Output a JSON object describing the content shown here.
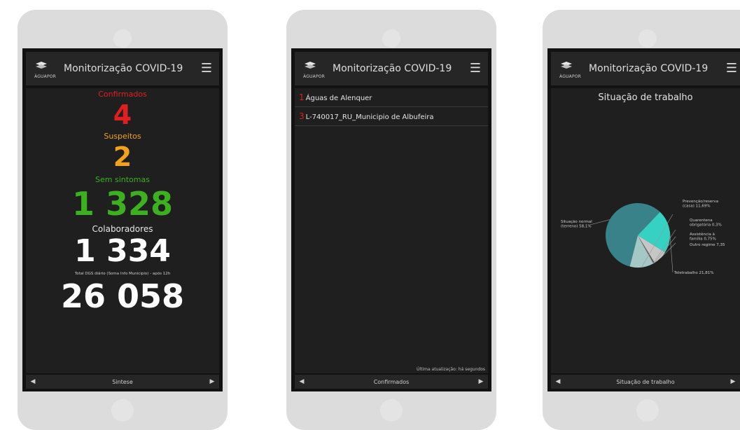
{
  "colors": {
    "confirmed": "#e02020",
    "suspected": "#f2a31b",
    "no_symptoms": "#3cb021",
    "white": "#ffffff",
    "app_bar": "#262626",
    "screen_bg": "#1f1f1f"
  },
  "phones": [
    {
      "app_title": "Monitorização COVID-19",
      "logo_text": "ÀGUAPOR",
      "menu_icon": "☰",
      "stats": {
        "confirmed_label": "Confirmados",
        "confirmed_value": "4",
        "suspected_label": "Suspeitos",
        "suspected_value": "2",
        "no_symptoms_label": "Sem sintomas",
        "no_symptoms_value": "1 328",
        "employees_label": "Colaboradores",
        "employees_value": "1 334",
        "dgs_label": "Total DGS diário (Soma Info Municipio) - após 12h",
        "dgs_value": "26 058"
      },
      "footer": {
        "prev": "◀",
        "label": "Sintese",
        "next": "▶"
      }
    },
    {
      "app_title": "Monitorização COVID-19",
      "logo_text": "ÀGUAPOR",
      "menu_icon": "☰",
      "list": [
        {
          "num": "1",
          "name": "Águas de Alenquer"
        },
        {
          "num": "3",
          "name": "L-740017_RU_Municipio de Albufeira"
        }
      ],
      "update_note": "Última atualização: há segundos",
      "footer": {
        "prev": "◀",
        "label": "Confirmados",
        "next": "▶"
      }
    },
    {
      "app_title": "Monitorização COVID-19",
      "logo_text": "ÀGUAPOR",
      "menu_icon": "☰",
      "chart_title": "Situação de trabalho",
      "footer": {
        "prev": "◀",
        "label": "Situação de trabalho",
        "next": "▶"
      }
    }
  ],
  "chart_data": {
    "type": "pie",
    "title": "Situação de trabalho",
    "slices": [
      {
        "label": "Situação normal (terreno) 58,1%",
        "line1": "Situação normal",
        "line2": "(terreno) 58,1%",
        "value": 58.1,
        "color": "#3a8289"
      },
      {
        "label": "Teletrabalho 21,81%",
        "line1": "Teletrabalho 21,81%",
        "line2": "",
        "value": 21.81,
        "color": "#35d1c2"
      },
      {
        "label": "Outro regime 7,35%",
        "line1": "Outro regime 7,35",
        "line2": "",
        "value": 7.35,
        "color": "#c6c6c6"
      },
      {
        "label": "Assistência à família 0,75%",
        "line1": "Assistência à",
        "line2": "família 0,75%",
        "value": 0.75,
        "color": "#5a5a5a"
      },
      {
        "label": "Quarentena obrigatória 0,3%",
        "line1": "Quarentena",
        "line2": "obrigatória 0,3%",
        "value": 0.3,
        "color": "#e0e0e0"
      },
      {
        "label": "Prevenção/reserva (casa) 11,69%",
        "line1": "Prevenção/reserva",
        "line2": "(casa) 11,69%",
        "value": 11.69,
        "color": "#a3c8c5"
      }
    ]
  }
}
